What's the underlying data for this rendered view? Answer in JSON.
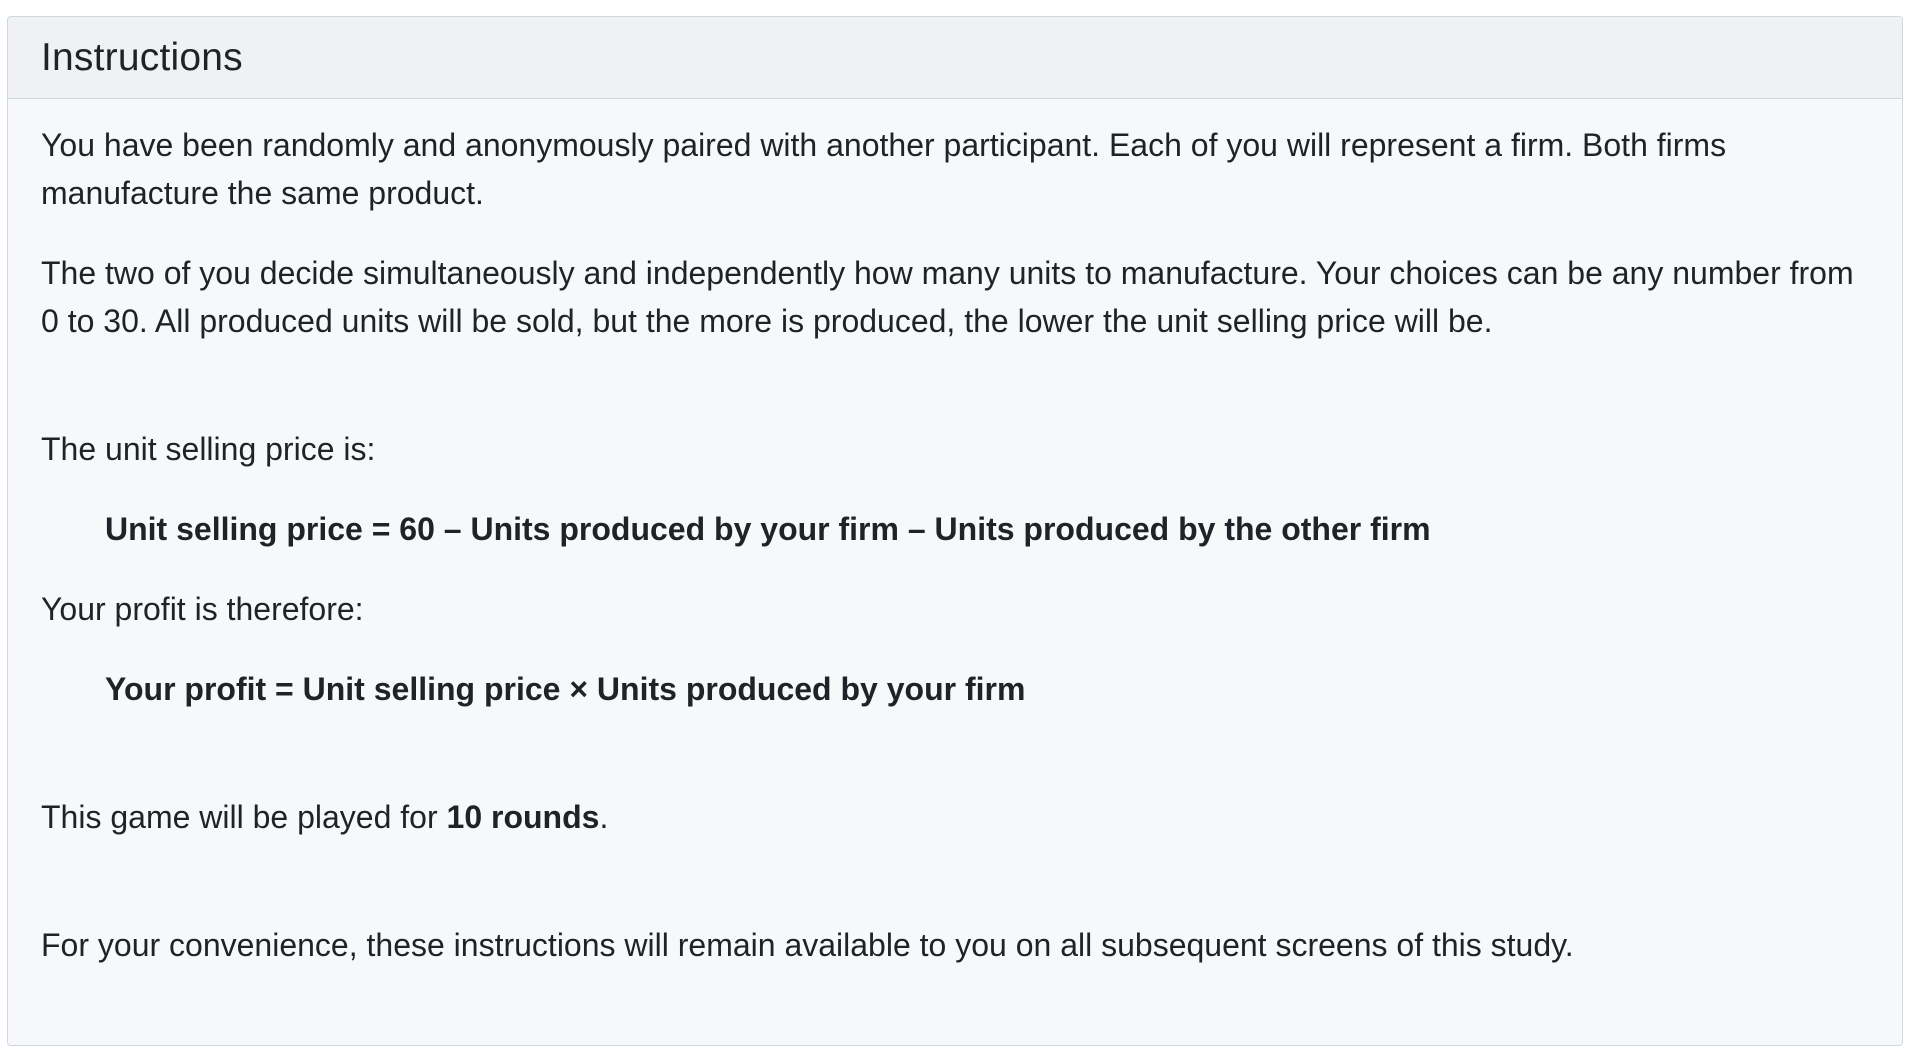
{
  "panel": {
    "title": "Instructions"
  },
  "body": {
    "para1": "You have been randomly and anonymously paired with another participant. Each of you will represent a firm. Both firms manufacture the same product.",
    "para2": "The two of you decide simultaneously and independently how many units to manufacture. Your choices can be any number from 0 to 30. All produced units will be sold, but the more is produced, the lower the unit selling price will be.",
    "price_intro": "The unit selling price is:",
    "price_formula": "Unit selling price = 60 – Units produced by your firm – Units produced by the other firm",
    "profit_intro": "Your profit is therefore:",
    "profit_formula": "Your profit = Unit selling price × Units produced by your firm",
    "rounds_prefix": "This game will be played for ",
    "rounds_bold": "10 rounds",
    "rounds_suffix": ".",
    "convenience": "For your convenience, these instructions will remain available to you on all subsequent screens of this study."
  }
}
